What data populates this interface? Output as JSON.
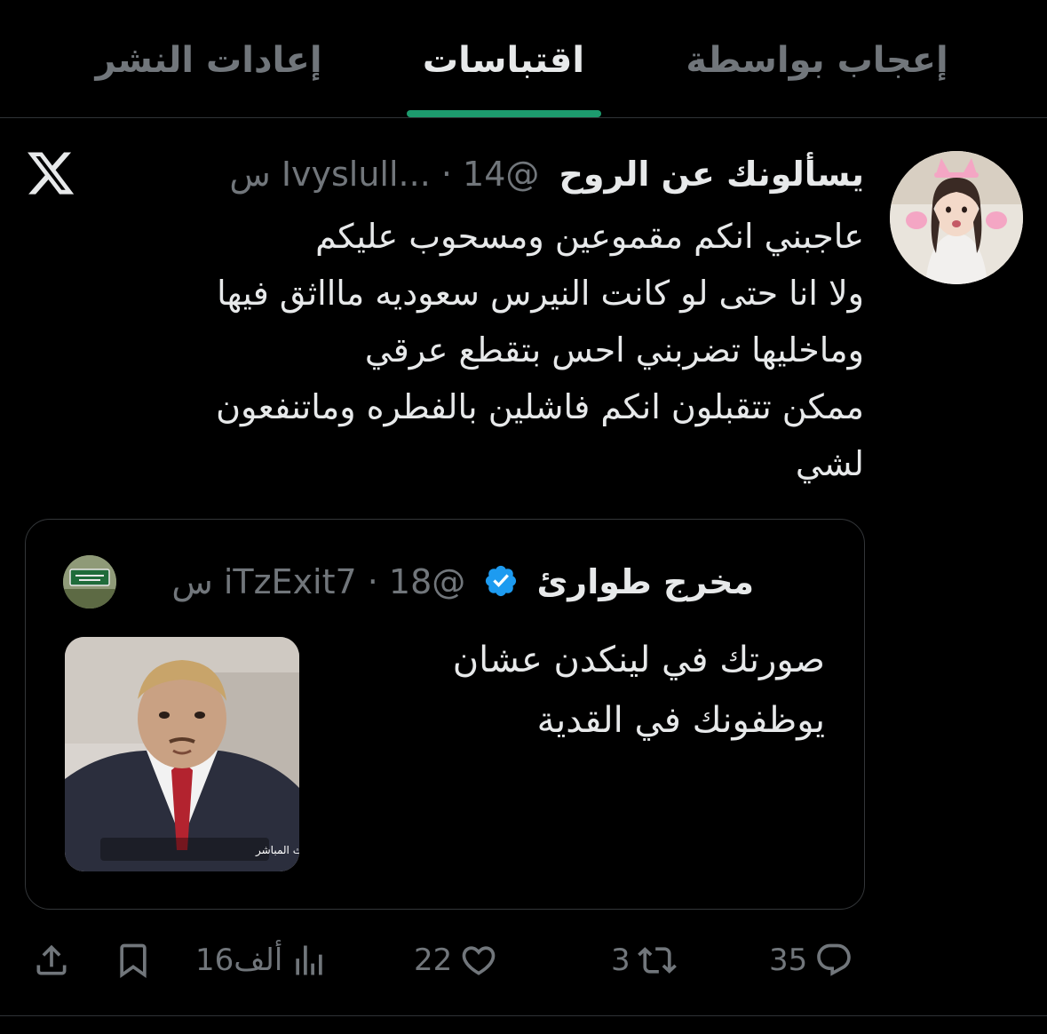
{
  "tabs": [
    {
      "label": "إعادات النشر",
      "active": false
    },
    {
      "label": "اقتباسات",
      "active": true
    },
    {
      "label": "إعجاب بواسطة",
      "active": false
    }
  ],
  "tweet": {
    "author_name": "يسألونك عن الروح",
    "meta": "@Ivyslull... · 14 س",
    "text": "عاجبني انكم مقموعين ومسحوب عليكم\nولا انا حتى لو كانت النيرس سعوديه ماااثق فيها\nوماخليها تضربني احس بتقطع عرقي\nممكن تتقبلون انكم فاشلين بالفطره وماتنفعون\nلشي"
  },
  "quote": {
    "author_name": "مخرج طوارئ",
    "meta": "@iTzExit7 · 18 س",
    "text": "صورتك في لينكدن عشان\nيوظفونك في القدية",
    "media_caption": "اضغط هنا لمشاهدة البث المباشر",
    "avatar_sign_text": "مخرج طوارئ"
  },
  "actions": {
    "replies": "35",
    "reposts": "3",
    "likes": "22",
    "views": "16ألف"
  },
  "colors": {
    "accent": "#1d9b6e",
    "muted": "#71767b",
    "text": "#e7e9ea",
    "verified": "#1d9bf0"
  },
  "icons": [
    "x-logo-icon",
    "verified-badge-icon",
    "reply-icon",
    "repost-icon",
    "like-icon",
    "views-icon",
    "bookmark-icon",
    "share-icon"
  ]
}
